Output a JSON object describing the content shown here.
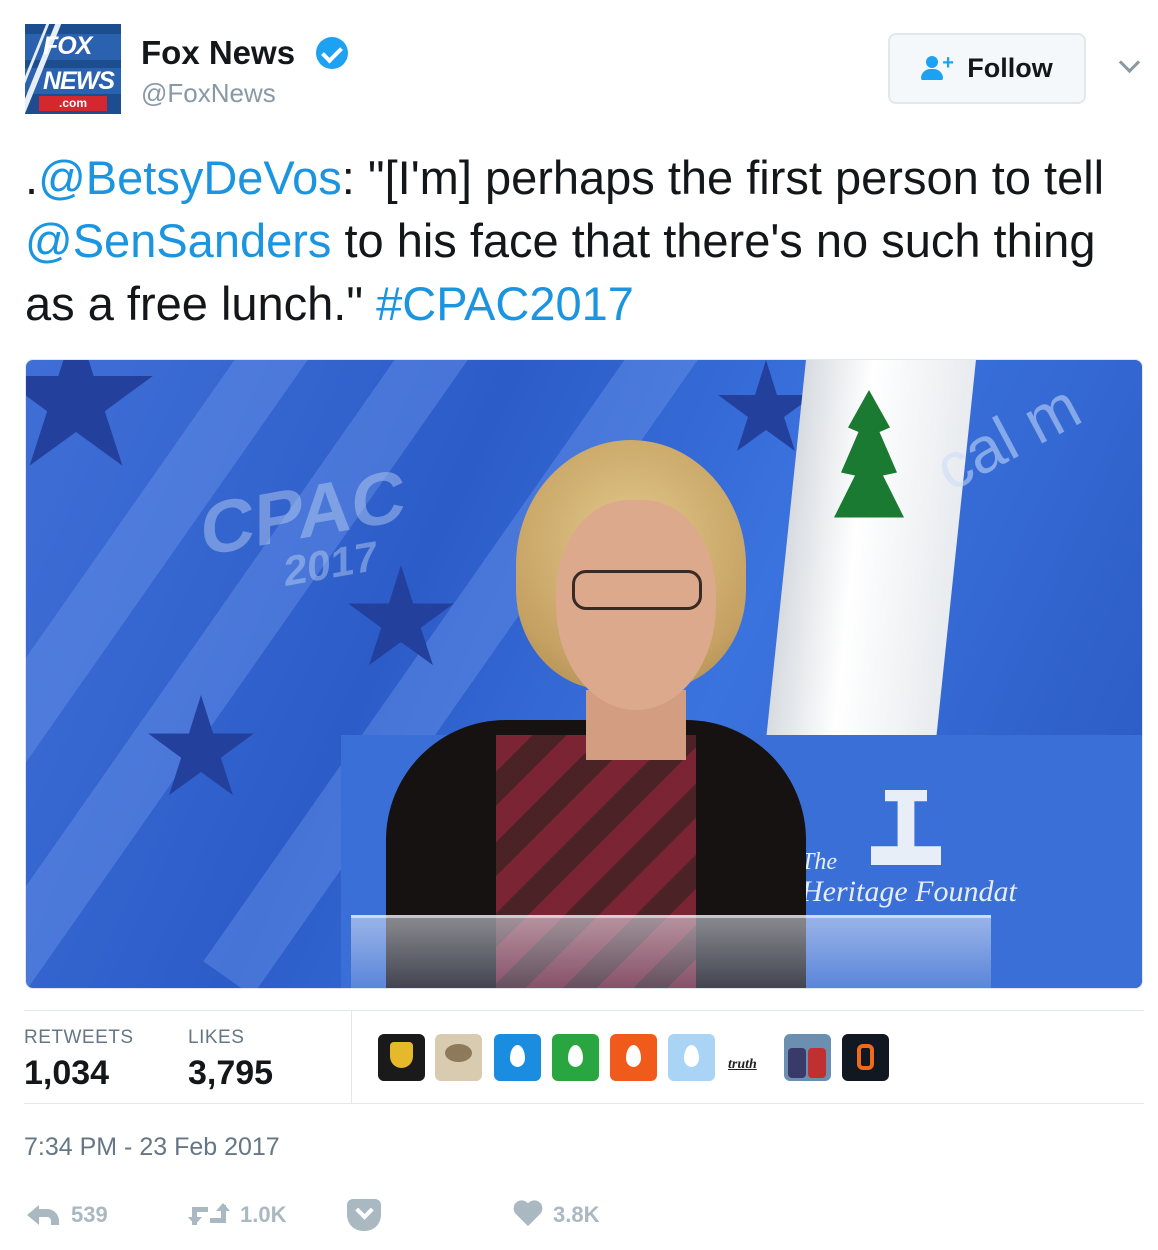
{
  "header": {
    "logo": {
      "line1": "FOX",
      "line2": "NEWS",
      "suffix": ".com"
    },
    "display_name": "Fox News",
    "handle": "@FoxNews",
    "verified": true,
    "follow_label": "Follow"
  },
  "tweet": {
    "text_prefix": ".",
    "mention1": "@BetsyDeVos",
    "text_part1": ": \"[I'm] perhaps the first person to tell ",
    "mention2": "@SenSanders",
    "text_part2": " to his face that there's no such thing as a free lunch.\" ",
    "hashtag": "#CPAC2017"
  },
  "media": {
    "scene_text": {
      "cpac": "CPAC",
      "year": "2017",
      "banner": "cal m",
      "heritage_the": "The",
      "heritage": "Heritage Foundat"
    }
  },
  "stats": {
    "retweets_label": "RETWEETS",
    "retweets_value": "1,034",
    "likes_label": "LIKES",
    "likes_value": "3,795",
    "truth_label": "truth"
  },
  "timestamp": "7:34 PM - 23 Feb 2017",
  "actions": {
    "reply_count": "539",
    "retweet_count": "1.0K",
    "like_count": "3.8K"
  },
  "colors": {
    "link": "#1b95e0",
    "verified": "#1da1f2",
    "muted": "#657786",
    "action": "#aab8c2"
  },
  "icons": [
    "verified-badge-icon",
    "follow-person-icon",
    "chevron-down-icon",
    "reply-icon",
    "retweet-icon",
    "pocket-icon",
    "heart-icon"
  ]
}
